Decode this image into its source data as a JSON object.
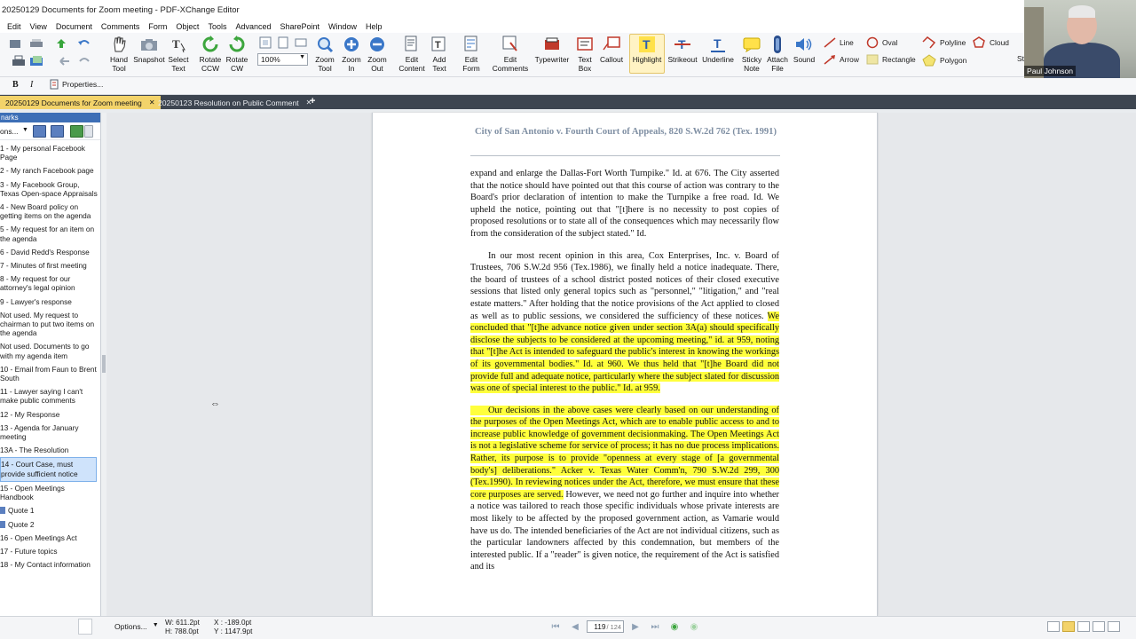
{
  "window": {
    "title": "20250129 Documents for Zoom meeting - PDF-XChange Editor",
    "minimize": "—",
    "maximize": "☐"
  },
  "menu": [
    "Edit",
    "View",
    "Document",
    "Comments",
    "Form",
    "Object",
    "Tools",
    "Advanced",
    "SharePoint",
    "Window",
    "Help"
  ],
  "toolbar": {
    "zoom_value": "100%",
    "tools": [
      {
        "id": "hand",
        "label": "Hand\nTool"
      },
      {
        "id": "snapshot",
        "label": "Snapshot"
      },
      {
        "id": "select-text",
        "label": "Select\nText"
      },
      {
        "id": "rotate-ccw",
        "label": "Rotate\nCCW"
      },
      {
        "id": "rotate-cw",
        "label": "Rotate\nCW"
      },
      {
        "id": "zoom-tool",
        "label": "Zoom\nTool"
      },
      {
        "id": "zoom-in",
        "label": "Zoom\nIn"
      },
      {
        "id": "zoom-out",
        "label": "Zoom\nOut"
      },
      {
        "id": "edit-content",
        "label": "Edit\nContent"
      },
      {
        "id": "add-text",
        "label": "Add\nText"
      },
      {
        "id": "edit-form",
        "label": "Edit\nForm"
      },
      {
        "id": "edit-comments",
        "label": "Edit\nComments"
      },
      {
        "id": "typewriter",
        "label": "Typewriter"
      },
      {
        "id": "text-box",
        "label": "Text\nBox"
      },
      {
        "id": "callout",
        "label": "Callout"
      },
      {
        "id": "highlight",
        "label": "Highlight"
      },
      {
        "id": "strikeout",
        "label": "Strikeout"
      },
      {
        "id": "underline",
        "label": "Underline"
      },
      {
        "id": "sticky-note",
        "label": "Sticky\nNote"
      },
      {
        "id": "attach-file",
        "label": "Attach\nFile"
      },
      {
        "id": "sound",
        "label": "Sound"
      }
    ],
    "shapes": {
      "line": "Line",
      "oval": "Oval",
      "polyline": "Polyline",
      "cloud": "Cloud",
      "arrow": "Arrow",
      "rectangle": "Rectangle",
      "polygon": "Polygon"
    },
    "overflow": "St"
  },
  "formatbar": {
    "bold": "B",
    "italic": "I",
    "properties": "Properties..."
  },
  "tabs": [
    {
      "label": "20250129 Documents for Zoom meeting",
      "active": true
    },
    {
      "label": "20250123 Resolution on Public Comment",
      "active": false
    }
  ],
  "bookmarks": {
    "header": "narks",
    "options_label": "ons...",
    "items": [
      {
        "text": "1 - My personal Facebook Page",
        "selected": false,
        "sub": false
      },
      {
        "text": "2 - My ranch Facebook page",
        "selected": false,
        "sub": false
      },
      {
        "text": "3 - My Facebook Group, Texas Open-space Appraisals",
        "selected": false,
        "sub": false
      },
      {
        "text": "4 - New Board policy on getting items on the agenda",
        "selected": false,
        "sub": false
      },
      {
        "text": "5 - My request for an item on the agenda",
        "selected": false,
        "sub": false
      },
      {
        "text": "6 - David Redd's Response",
        "selected": false,
        "sub": false
      },
      {
        "text": "7 - Minutes of first meeting",
        "selected": false,
        "sub": false
      },
      {
        "text": "8 - My request for our attorney's legal opinion",
        "selected": false,
        "sub": false
      },
      {
        "text": "9 - Lawyer's response",
        "selected": false,
        "sub": false
      },
      {
        "text": "Not used. My request to chairman to put two items on the agenda",
        "selected": false,
        "sub": false
      },
      {
        "text": "Not used. Documents to go with my agenda item",
        "selected": false,
        "sub": false
      },
      {
        "text": "10 - Email from Faun to Brent South",
        "selected": false,
        "sub": false
      },
      {
        "text": "11 - Lawyer saying I can't make public comments",
        "selected": false,
        "sub": false
      },
      {
        "text": "12 - My Response",
        "selected": false,
        "sub": false
      },
      {
        "text": "13 - Agenda for January meeting",
        "selected": false,
        "sub": false
      },
      {
        "text": "13A - The Resolution",
        "selected": false,
        "sub": false
      },
      {
        "text": "14 - Court Case, must provide sufficient notice",
        "selected": true,
        "sub": false
      },
      {
        "text": "15 - Open Meetings Handbook",
        "selected": false,
        "sub": false
      },
      {
        "text": "Quote 1",
        "selected": false,
        "sub": true
      },
      {
        "text": "Quote 2",
        "selected": false,
        "sub": true
      },
      {
        "text": "16 - Open Meetings Act",
        "selected": false,
        "sub": false
      },
      {
        "text": "17 - Future topics",
        "selected": false,
        "sub": false
      },
      {
        "text": "18 - My Contact information",
        "selected": false,
        "sub": false
      }
    ]
  },
  "document": {
    "case_title": "City of San Antonio v. Fourth Court of Appeals, 820 S.W.2d 762 (Tex. 1991)",
    "p1": "expand and enlarge the Dallas-Fort Worth Turnpike.\" Id. at 676. The City asserted that the notice should have pointed out that this course of action was contrary to the Board's prior declaration of intention to make the Turnpike a free road. Id. We upheld the notice, pointing out that \"[t]here is no necessity to post copies of proposed resolutions or to state all of the consequences which may necessarily flow from the consideration of the subject stated.\" Id.",
    "p2_plain": "In our most recent opinion in this area, Cox Enterprises, Inc. v. Board of Trustees, 706 S.W.2d 956 (Tex.1986), we finally held a notice inadequate. There, the board of trustees of a school district posted notices of their closed executive sessions that listed only general topics such as \"personnel,\" \"litigation,\" and \"real estate matters.\" After holding that the notice provisions of the Act applied to closed as well as to public sessions, we considered the sufficiency of these notices.",
    "p2_hl": "We concluded that \"[t]he advance notice given under section 3A(a) should specifically disclose the subjects to be considered at the upcoming meeting,\" id. at 959, noting that \"[t]he Act is intended to safeguard the public's interest in knowing the workings of its governmental bodies.\" Id. at 960. We thus held that \"[t]he Board did not provide full and adequate notice, particularly where the subject slated for discussion was one of special interest to the public.\" Id. at 959.",
    "p3_hl": "Our decisions in the above cases were clearly based on our understanding of the purposes of the Open Meetings Act, which are to enable public access to and to increase public knowledge of government decisionmaking. The Open Meetings Act is not a legislative scheme for service of process; it has no due process implications. Rather, its purpose is to provide \"openness at every stage of [a governmental body's] deliberations.\" Acker v. Texas Water Comm'n, 790 S.W.2d 299, 300 (Tex.1990). In reviewing notices under the Act, therefore, we must ensure that these core purposes are served.",
    "p3_plain": "However, we need not go further and inquire into whether a notice was tailored to reach those specific individuals whose private interests are most likely to be affected by the proposed government action, as Vamarie would have us do. The intended beneficiaries of the Act are not individual citizens, such as the particular landowners affected by this condemnation, but members of the interested public. If a \"reader\" is given notice, the requirement of the Act is satisfied and its"
  },
  "status": {
    "options": "Options...",
    "w": "W: 611.2pt",
    "h": "H: 788.0pt",
    "x": "X : -189.0pt",
    "y": "Y : 1147.9pt",
    "page_current": "119",
    "page_total": "/ 124"
  },
  "webcam": {
    "name": "Paul Johnson"
  },
  "colors": {
    "highlight": "#ffff3c",
    "tab_active": "#f3d36a",
    "tab_bar": "#3d4550",
    "case_title": "#7f8fa3"
  }
}
